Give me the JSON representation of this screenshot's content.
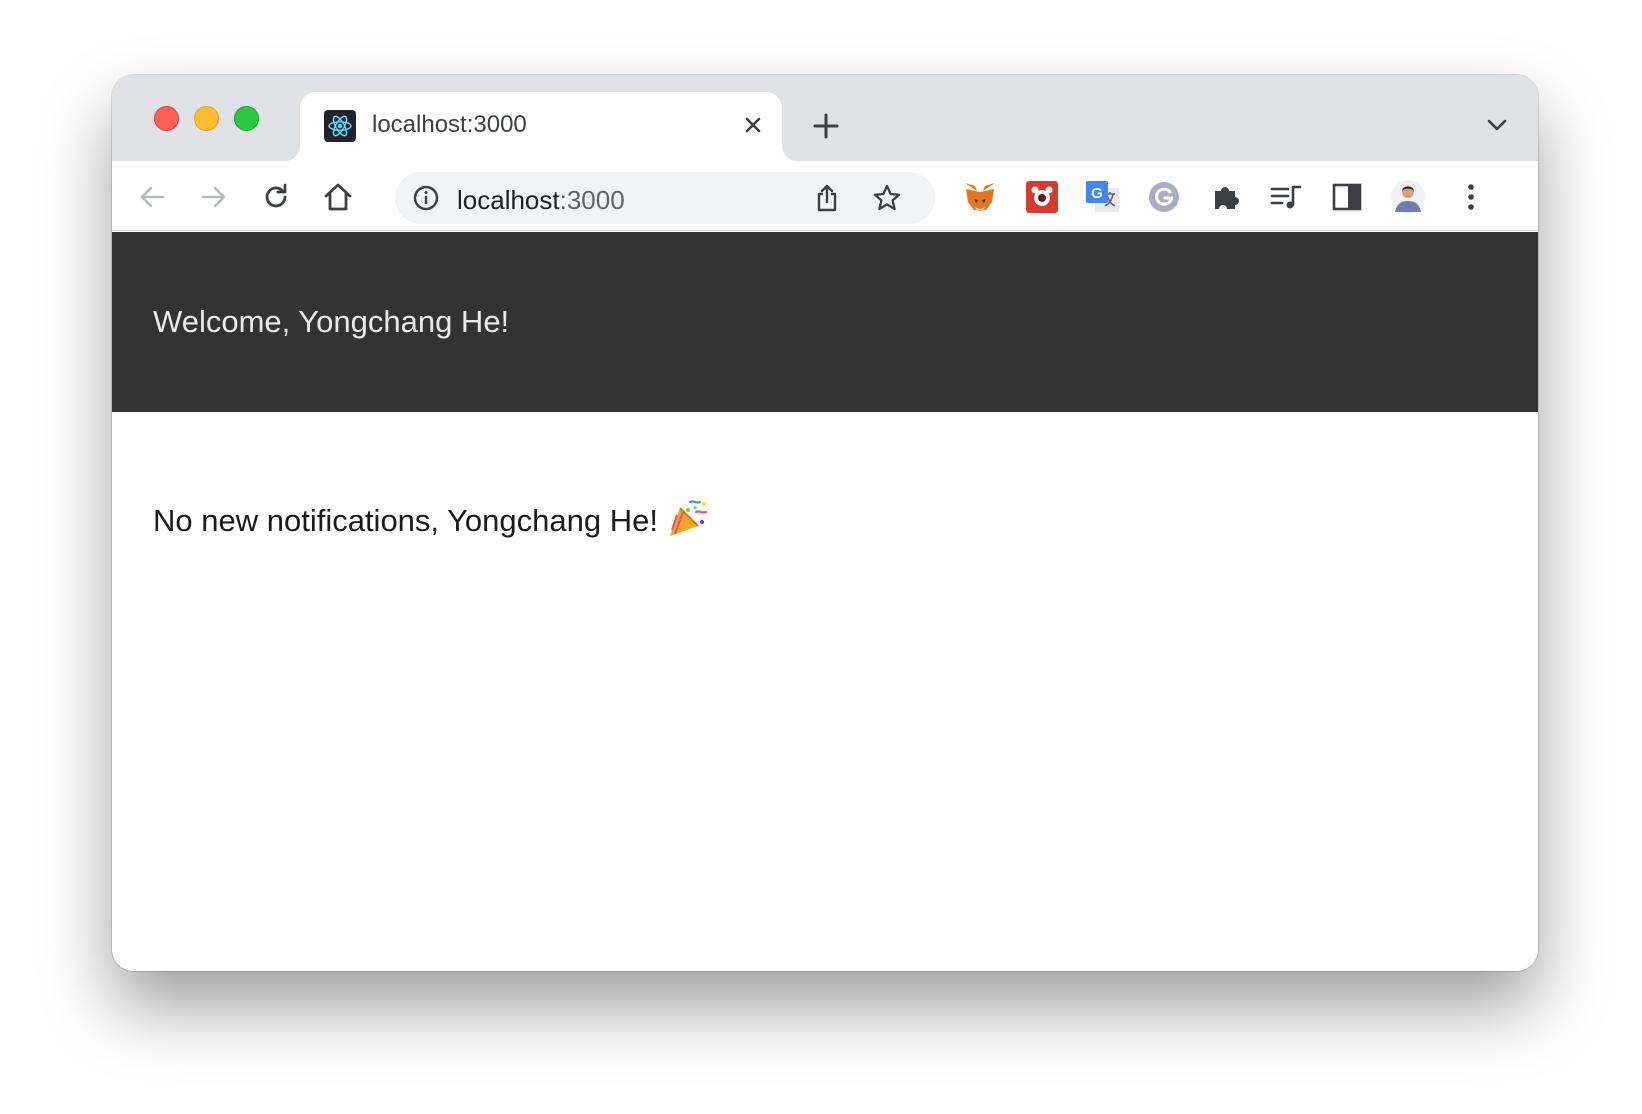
{
  "browser": {
    "tab": {
      "title": "localhost:3000",
      "favicon": "react-logo-icon"
    },
    "address_bar": {
      "host": "localhost",
      "port": ":3000"
    },
    "colors": {
      "tabstrip": "#dee1e6",
      "traffic_red": "#ff5f57",
      "traffic_yellow": "#febc2e",
      "traffic_green": "#28c840"
    },
    "extensions": [
      "metamask-fox-icon",
      "red-extension-icon",
      "google-translate-icon",
      "grammarly-icon",
      "puzzle-extensions-icon",
      "media-queue-icon",
      "side-panel-icon",
      "profile-avatar"
    ]
  },
  "page": {
    "header": {
      "welcome_text": "Welcome, Yongchang He!",
      "background": "#333333"
    },
    "notification_text": "No new notifications, Yongchang He!",
    "notification_emoji": "🎉"
  }
}
